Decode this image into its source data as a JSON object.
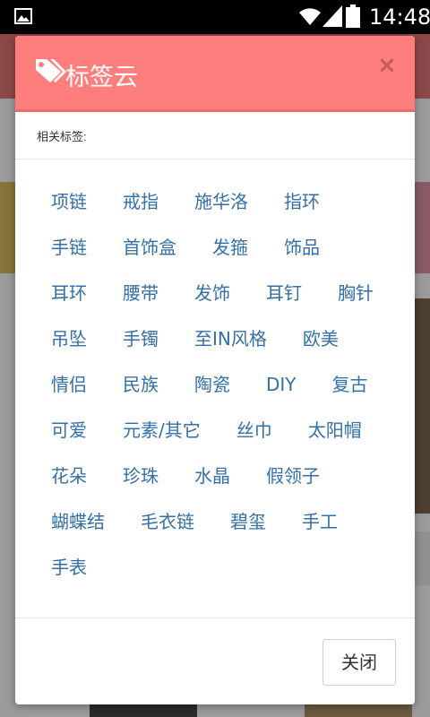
{
  "statusbar": {
    "time": "14:48",
    "icons": [
      "image-icon",
      "wifi-icon",
      "signal-icon",
      "battery-icon"
    ]
  },
  "dialog": {
    "title": "标签云",
    "title_icon": "tag-icon",
    "close_x": "×",
    "subtitle": "相关标签:",
    "tag_rows": [
      [
        "项链",
        "戒指",
        "施华洛",
        "指环"
      ],
      [
        "手链",
        "首饰盒",
        "发箍",
        "饰品"
      ],
      [
        "耳环",
        "腰带",
        "发饰",
        "耳钉",
        "胸针"
      ],
      [
        "吊坠",
        "手镯",
        "至IN风格",
        "欧美"
      ],
      [
        "情侣",
        "民族",
        "陶瓷",
        "DIY",
        "复古"
      ],
      [
        "可爱",
        "元素/其它",
        "丝巾",
        "太阳帽"
      ],
      [
        "花朵",
        "珍珠",
        "水晶",
        "假领子"
      ],
      [
        "蝴蝶结",
        "毛衣链",
        "碧玺",
        "手工"
      ],
      [
        "手表"
      ]
    ],
    "close_button": "关闭"
  },
  "colors": {
    "header": "#fe7e7e",
    "tag_text": "#3470a6",
    "status_bar": "#000000"
  }
}
